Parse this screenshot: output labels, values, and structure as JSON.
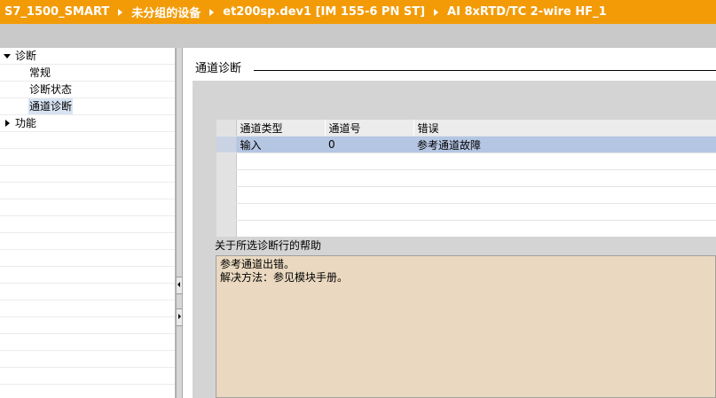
{
  "breadcrumb": {
    "items": [
      "S7_1500_SMART",
      "未分组的设备",
      "et200sp.dev1 [IM 155-6 PN ST]",
      "AI 8xRTD/TC 2-wire HF_1"
    ],
    "background": "#f39b07"
  },
  "nav": {
    "items": [
      {
        "label": "诊断",
        "expanded": true
      },
      {
        "label": "常规"
      },
      {
        "label": "诊断状态"
      },
      {
        "label": "通道诊断",
        "selected": true
      },
      {
        "label": "功能",
        "expanded": false
      }
    ]
  },
  "content": {
    "section_title": "通道诊断",
    "table": {
      "columns": [
        "通道类型",
        "通道号",
        "错误"
      ],
      "rows": [
        [
          "输入",
          "0",
          "参考通道故障"
        ]
      ]
    },
    "help": {
      "label": "关于所选诊断行的帮助",
      "lines": [
        "参考通道出错。",
        "解决方法：参见模块手册。"
      ]
    }
  }
}
